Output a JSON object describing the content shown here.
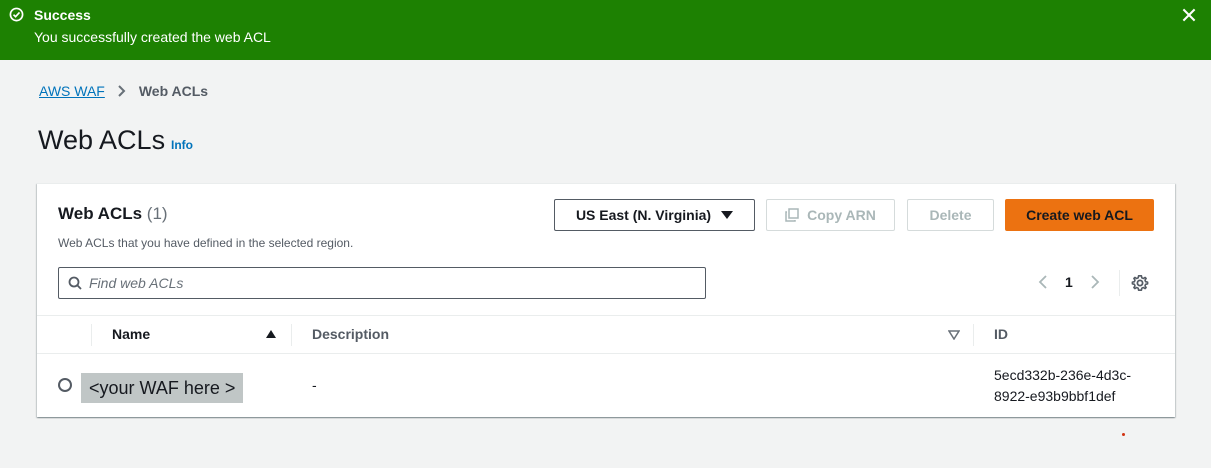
{
  "flash": {
    "title": "Success",
    "message": "You successfully created the web ACL",
    "color": "#1d8102"
  },
  "breadcrumb": {
    "items": [
      "AWS WAF",
      "Web ACLs"
    ]
  },
  "page": {
    "title": "Web ACLs",
    "info_label": "Info"
  },
  "panel": {
    "title": "Web ACLs",
    "count": "(1)",
    "description": "Web ACLs that you have defined in the selected region.",
    "region_label": "US East (N. Virginia)",
    "copy_arn_label": "Copy ARN",
    "delete_label": "Delete",
    "create_label": "Create web ACL",
    "accent_color": "#ec7211"
  },
  "search": {
    "placeholder": "Find web ACLs",
    "value": ""
  },
  "pagination": {
    "current_page": "1"
  },
  "table": {
    "columns": [
      "Name",
      "Description",
      "ID"
    ],
    "rows": [
      {
        "name": "<your WAF here >",
        "description": "-",
        "id_line1": "5ecd332b-236e-4d3c-",
        "id_line2": "8922-e93b9bbf1def"
      }
    ]
  }
}
